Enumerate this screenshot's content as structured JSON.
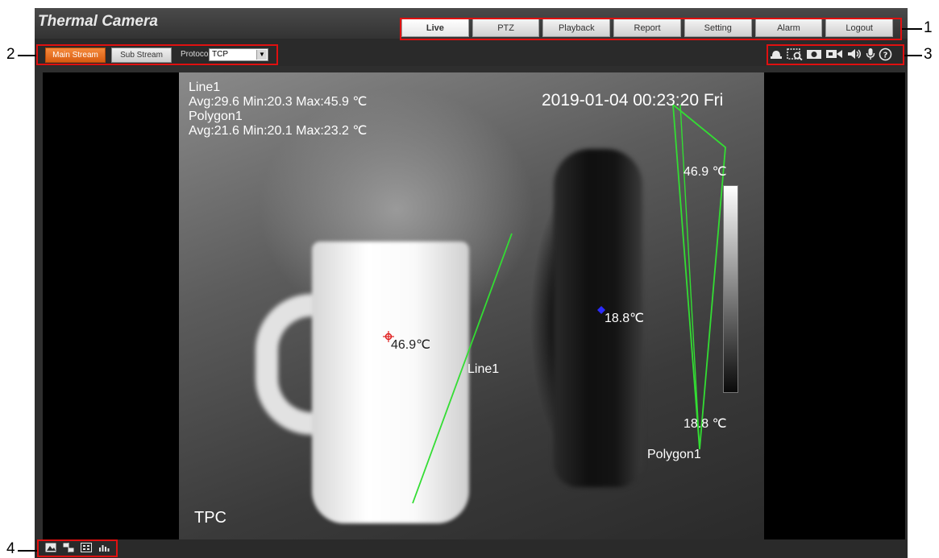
{
  "app": {
    "title": "Thermal Camera"
  },
  "nav": {
    "tabs": [
      "Live",
      "PTZ",
      "Playback",
      "Report",
      "Setting",
      "Alarm",
      "Logout"
    ],
    "active": "Live"
  },
  "stream": {
    "main_label": "Main Stream",
    "sub_label": "Sub Stream",
    "protocol_label": "Protocol",
    "protocol_value": "TCP"
  },
  "toolbar_icons": [
    "alarm-bell-icon",
    "zoom-icon",
    "snapshot-icon",
    "record-icon",
    "audio-icon",
    "microphone-icon",
    "help-icon"
  ],
  "video": {
    "info_lines": [
      "Line1",
      "Avg:29.6 Min:20.3 Max:45.9 ℃",
      "Polygon1",
      "Avg:21.6 Min:20.1 Max:23.2 ℃"
    ],
    "timestamp": "2019-01-04 00:23:20 Fri",
    "scale_max": "46.9 ℃",
    "scale_min": "18.8 ℃",
    "line_label": "Line1",
    "polygon_label": "Polygon1",
    "hot_spot": "46.9℃",
    "cold_spot": "18.8℃",
    "channel_label": "TPC",
    "overlay_color": "#33dd33"
  },
  "bottom_icons": [
    "original-size-icon",
    "fit-window-icon",
    "fullscreen-icon",
    "rule-info-icon"
  ],
  "callouts": [
    "1",
    "2",
    "3",
    "4"
  ],
  "colors": {
    "accent": "#f07a2a",
    "callout": "#e01010"
  }
}
